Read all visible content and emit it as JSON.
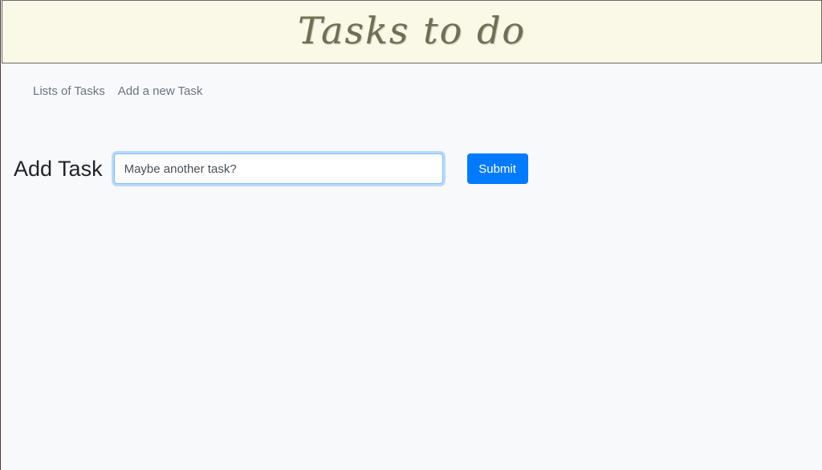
{
  "header": {
    "title": "Tasks to do"
  },
  "nav": {
    "items": [
      {
        "label": "Lists of Tasks"
      },
      {
        "label": "Add a new Task"
      }
    ]
  },
  "form": {
    "label": "Add Task",
    "input_value": "Maybe another task?",
    "submit_label": "Submit"
  },
  "colors": {
    "header_bg": "#faf8e6",
    "title_color": "#6e6f55",
    "primary": "#007bff",
    "page_bg": "#f8f9fa"
  }
}
